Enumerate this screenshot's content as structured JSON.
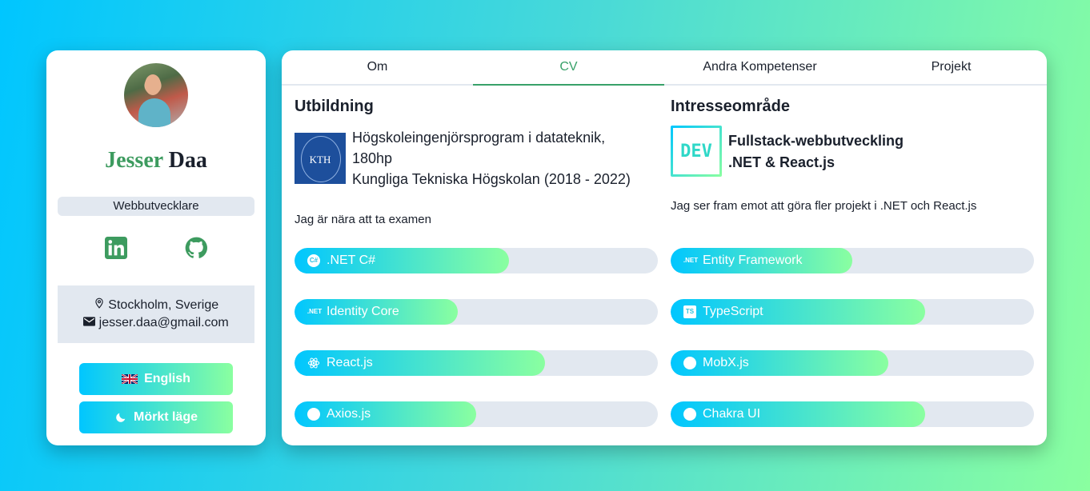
{
  "profile": {
    "first_name": "Jesser",
    "last_name": "Daa",
    "title": "Webbutvecklare",
    "location": "Stockholm, Sverige",
    "email": "jesser.daa@gmail.com",
    "language_button": "English",
    "dark_mode_button": "Mörkt läge"
  },
  "tabs": [
    "Om",
    "CV",
    "Andra Kompetenser",
    "Projekt"
  ],
  "active_tab": "CV",
  "education": {
    "heading": "Utbildning",
    "line1": "Högskoleingenjörsprogram i datateknik,",
    "line2": "180hp",
    "line3": "Kungliga Tekniska Högskolan (2018 - 2022)",
    "note": "Jag är nära att ta examen",
    "logo_text": "KTH"
  },
  "interest": {
    "heading": "Intresseområde",
    "line1": "Fullstack-webbutveckling",
    "line2": ".NET & React.js",
    "note": "Jag ser fram emot att göra fler projekt i .NET och React.js",
    "logo_text": "DEV"
  },
  "skills_left": [
    {
      "label": ".NET C#",
      "icon": "csharp-icon",
      "level": 0.59
    },
    {
      "label": "Identity Core",
      "icon": "dotnet-icon",
      "level": 0.45
    },
    {
      "label": "React.js",
      "icon": "react-icon",
      "level": 0.69
    },
    {
      "label": "Axios.js",
      "icon": "circle-icon",
      "level": 0.5
    }
  ],
  "skills_right": [
    {
      "label": "Entity Framework",
      "icon": "dotnet-icon",
      "level": 0.5
    },
    {
      "label": "TypeScript",
      "icon": "typescript-icon",
      "level": 0.7
    },
    {
      "label": "MobX.js",
      "icon": "circle-icon",
      "level": 0.6
    },
    {
      "label": "Chakra UI",
      "icon": "circle-icon",
      "level": 0.7
    }
  ],
  "colors": {
    "accent": "#38a169",
    "gradient_start": "#00c6ff",
    "gradient_end": "#8affa0"
  }
}
